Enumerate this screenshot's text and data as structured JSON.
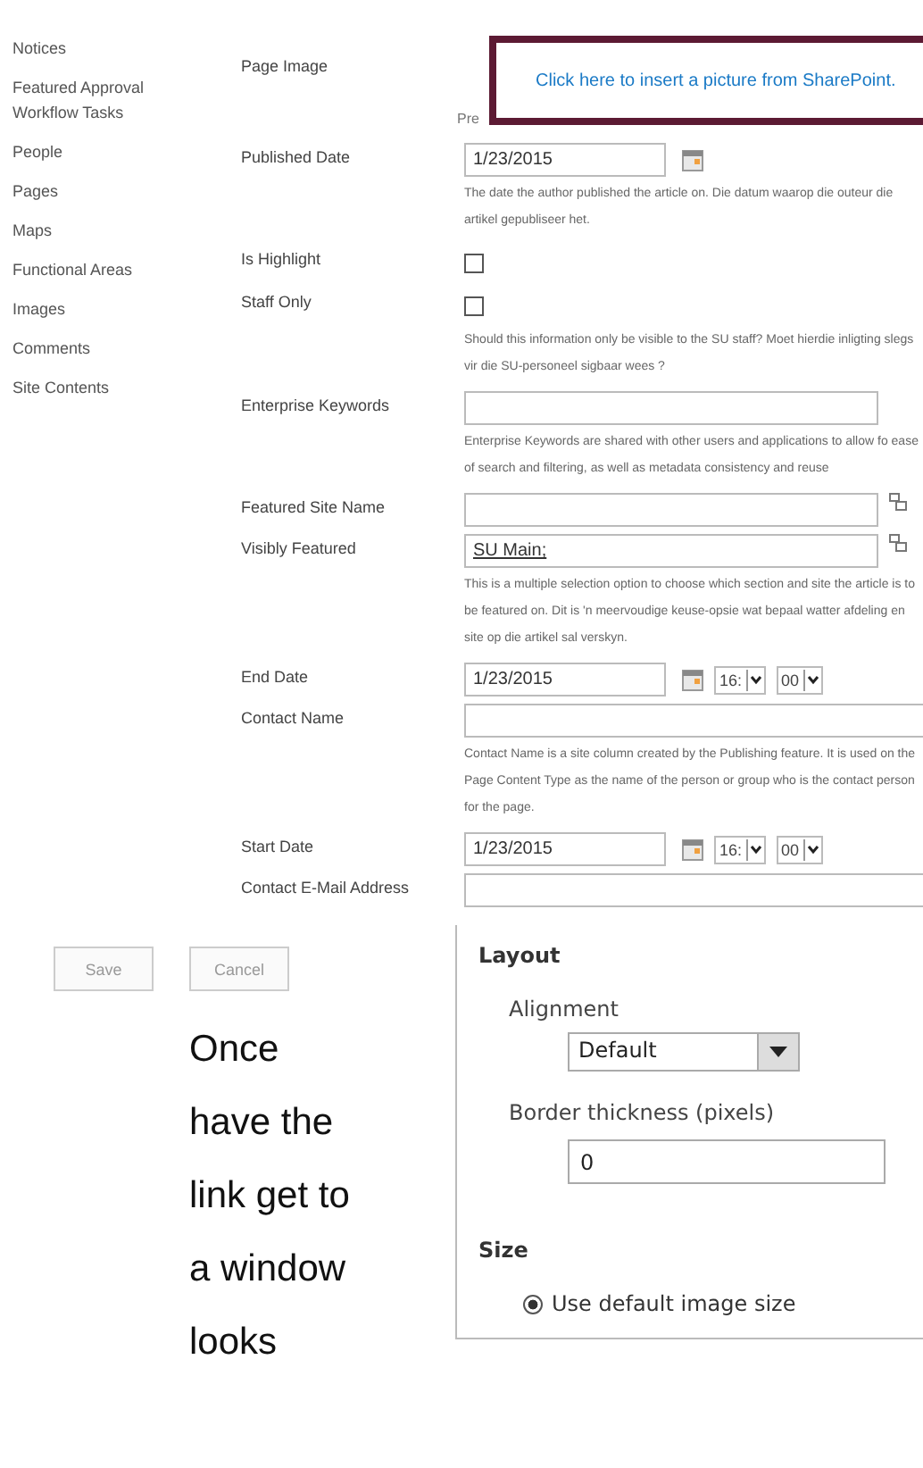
{
  "sidebar": {
    "items": [
      {
        "label": "Notices"
      },
      {
        "label": "Featured Approval Workflow Tasks"
      },
      {
        "label": "People"
      },
      {
        "label": "Pages"
      },
      {
        "label": "Maps"
      },
      {
        "label": "Functional Areas"
      },
      {
        "label": "Images"
      },
      {
        "label": "Comments"
      },
      {
        "label": "Site Contents"
      }
    ]
  },
  "form": {
    "fields": [
      {
        "kind": "image",
        "label": "Page Image",
        "link": "Click here to insert a picture from SharePoint.",
        "hint": "Pre"
      },
      {
        "kind": "date",
        "label": "Published Date",
        "value": "1/23/2015",
        "description": "The date the author published the article on. Die datum waarop die outeur die artikel gepubliseer het."
      },
      {
        "kind": "checkbox",
        "label": "Is Highlight",
        "checked": false
      },
      {
        "kind": "checkbox",
        "label": "Staff Only",
        "checked": false,
        "description": "Should this information only be visible to the SU staff? Moet hierdie inligting slegs vir die SU-personeel sigbaar wees ?"
      },
      {
        "kind": "text",
        "label": "Enterprise Keywords",
        "description": "Enterprise Keywords are shared with other users and applications to allow fo ease of search and filtering, as well as metadata consistency and reuse"
      },
      {
        "kind": "lookup",
        "label": "Featured Site Name"
      },
      {
        "kind": "lookup",
        "label": "Visibly Featured",
        "value": "SU Main;",
        "description": "This is a multiple selection option to choose which section and site the article is to be featured on. Dit is 'n meervoudige keuse-opsie wat bepaal watter afdeling en site op die artikel sal verskyn."
      },
      {
        "kind": "datetime",
        "label": "End Date",
        "value": "1/23/2015",
        "hour": "16:",
        "minute": "00"
      },
      {
        "kind": "wide",
        "label": "Contact Name",
        "description": "Contact Name is a site column created by the Publishing feature. It is used on the Page Content Type as the name of the person or group who is the contact person for the page."
      },
      {
        "kind": "datetime",
        "label": "Start Date",
        "value": "1/23/2015",
        "hour": "16:",
        "minute": "00"
      },
      {
        "kind": "wide",
        "label": "Contact E-Mail Address"
      }
    ],
    "buttons": [
      "Save",
      "Cancel"
    ]
  },
  "note": "Once have the link get to a window looks",
  "panel": {
    "title": "Layout",
    "alignment_label": "Alignment",
    "alignment_value": "Default",
    "border_label": "Border thickness (pixels)",
    "border_value": "0",
    "size_title": "Size",
    "size_options": [
      {
        "label": "Use default image size",
        "selected": true
      }
    ]
  }
}
